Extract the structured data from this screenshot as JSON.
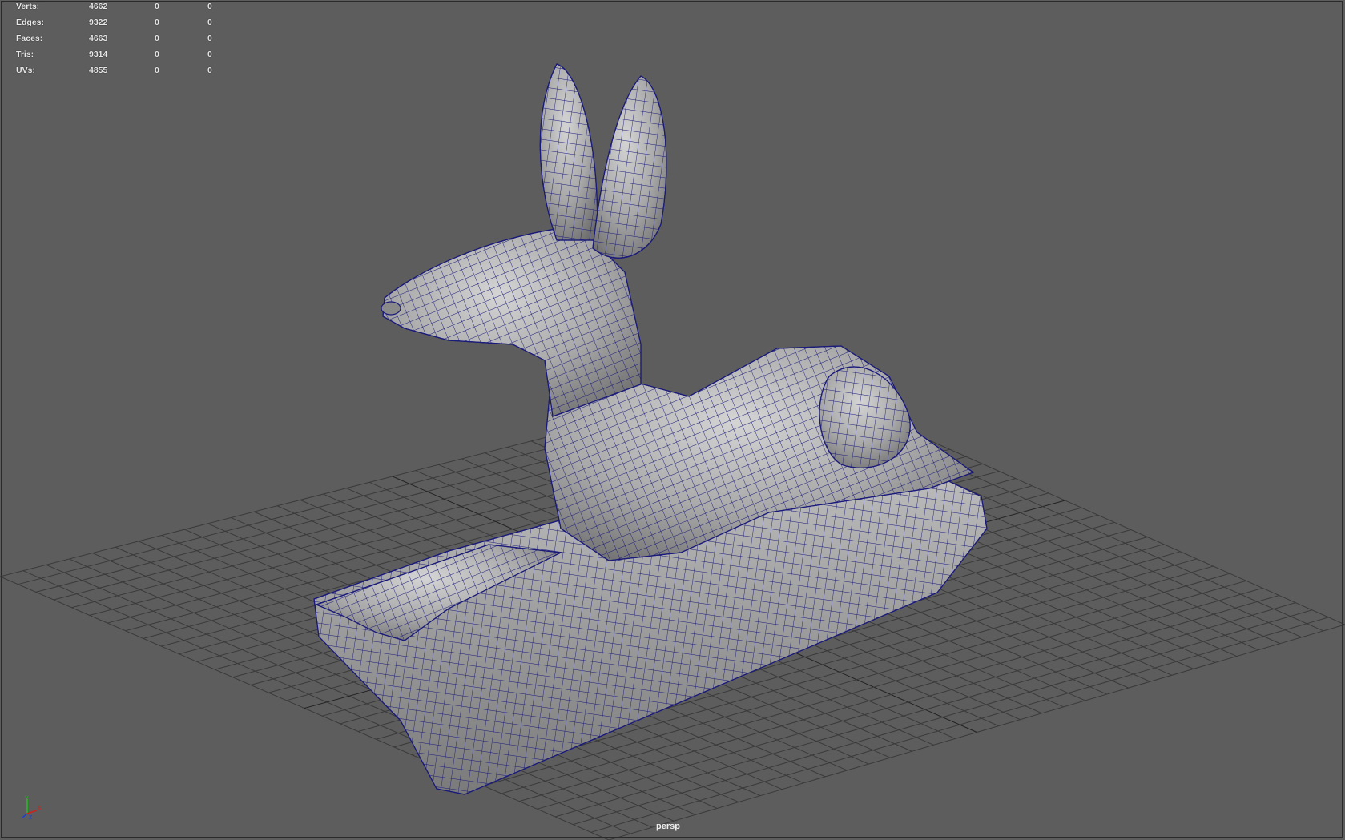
{
  "hud": {
    "rows": [
      {
        "label": "Verts:",
        "total": "4662",
        "selected": "0",
        "component": "0"
      },
      {
        "label": "Edges:",
        "total": "9322",
        "selected": "0",
        "component": "0"
      },
      {
        "label": "Faces:",
        "total": "4663",
        "selected": "0",
        "component": "0"
      },
      {
        "label": "Tris:",
        "total": "9314",
        "selected": "0",
        "component": "0"
      },
      {
        "label": "UVs:",
        "total": "4855",
        "selected": "0",
        "component": "0"
      }
    ]
  },
  "viewport": {
    "camera": "persp",
    "background_color": "#5d5d5d",
    "grid_color": "#3a3a3a",
    "wire_color": "#1a1a7a",
    "mesh_color": "#a8a8a8",
    "model": "anubis-jackal-statue-icon"
  },
  "axis_gizmo": {
    "x": "X",
    "y": "Y",
    "z": "Z",
    "x_color": "#d02020",
    "y_color": "#20c020",
    "z_color": "#2040d0"
  }
}
